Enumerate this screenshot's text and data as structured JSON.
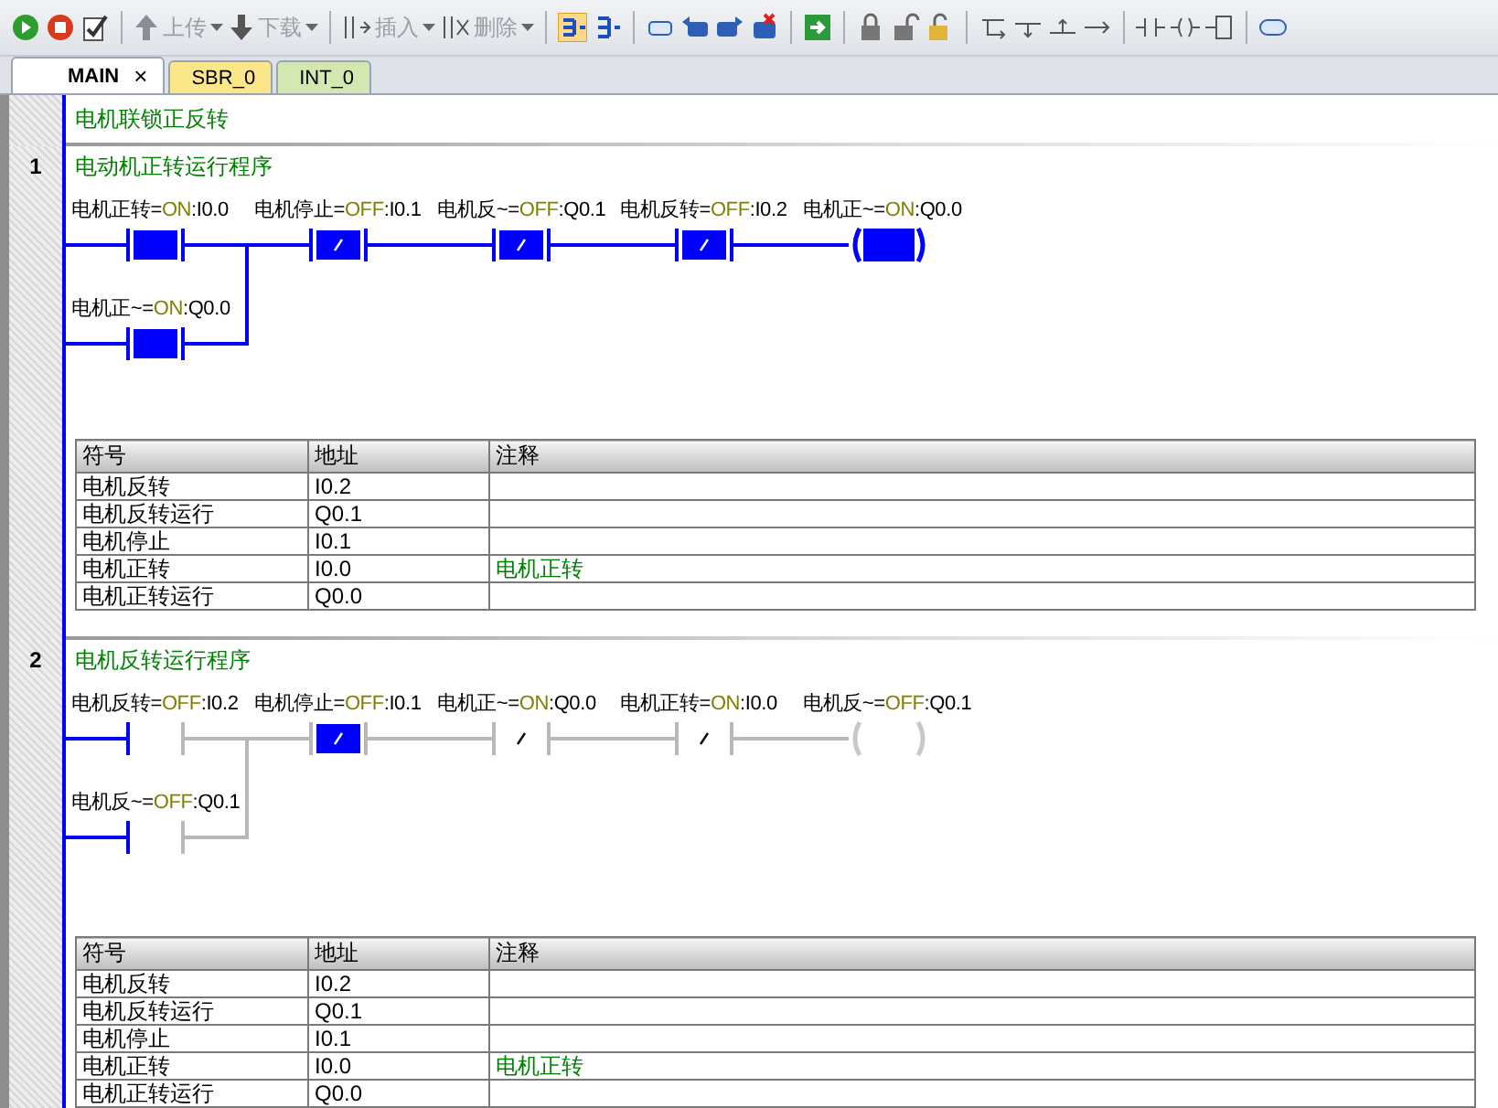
{
  "toolbar": {
    "buttons": [
      {
        "label": "上传",
        "disabled": true
      },
      {
        "label": "下载",
        "disabled": true
      },
      {
        "label": "插入",
        "disabled": true
      },
      {
        "label": "删除",
        "disabled": true
      }
    ]
  },
  "tabs": [
    {
      "label": "MAIN",
      "selected": true,
      "color": "#ffffff",
      "close": "×"
    },
    {
      "label": "SBR_0",
      "selected": false,
      "color": "#fbe68a"
    },
    {
      "label": "INT_0",
      "selected": false,
      "color": "#d3e8b0"
    }
  ],
  "program_title": "电机联锁正反转",
  "networks": [
    {
      "number": "1",
      "title": "电动机正转运行程序",
      "rung": [
        {
          "kind": "contact-no",
          "name": "电机正转=",
          "state": "ON",
          "address": ":I0.0",
          "powered": true,
          "active": true
        },
        {
          "kind": "contact-nc",
          "name": "电机停止=",
          "state": "OFF",
          "address": ":I0.1",
          "powered": true,
          "active": true
        },
        {
          "kind": "contact-nc",
          "name": "电机反~=",
          "state": "OFF",
          "address": ":Q0.1",
          "powered": true,
          "active": true
        },
        {
          "kind": "contact-nc",
          "name": "电机反转=",
          "state": "OFF",
          "address": ":I0.2",
          "powered": true,
          "active": true
        },
        {
          "kind": "coil",
          "name": "电机正~=",
          "state": "ON",
          "address": ":Q0.0",
          "powered": true,
          "active": true
        }
      ],
      "branch": {
        "kind": "contact-no",
        "name": "电机正~=",
        "state": "ON",
        "address": ":Q0.0",
        "powered": true,
        "active": true
      },
      "table": {
        "columns": [
          "符号",
          "地址",
          "注释"
        ],
        "rows": [
          [
            "电机反转",
            "I0.2",
            ""
          ],
          [
            "电机反转运行",
            "Q0.1",
            ""
          ],
          [
            "电机停止",
            "I0.1",
            ""
          ],
          [
            "电机正转",
            "I0.0",
            "电机正转"
          ],
          [
            "电机正转运行",
            "Q0.0",
            ""
          ]
        ]
      }
    },
    {
      "number": "2",
      "title": "电机反转运行程序",
      "rung": [
        {
          "kind": "contact-no",
          "name": "电机反转=",
          "state": "OFF",
          "address": ":I0.2",
          "powered": true,
          "active": false
        },
        {
          "kind": "contact-nc",
          "name": "电机停止=",
          "state": "OFF",
          "address": ":I0.1",
          "powered": false,
          "active": true
        },
        {
          "kind": "contact-nc",
          "name": "电机正~=",
          "state": "ON",
          "address": ":Q0.0",
          "powered": false,
          "active": false
        },
        {
          "kind": "contact-nc",
          "name": "电机正转=",
          "state": "ON",
          "address": ":I0.0",
          "powered": false,
          "active": false
        },
        {
          "kind": "coil",
          "name": "电机反~=",
          "state": "OFF",
          "address": ":Q0.1",
          "powered": false,
          "active": false
        }
      ],
      "branch": {
        "kind": "contact-no",
        "name": "电机反~=",
        "state": "OFF",
        "address": ":Q0.1",
        "powered": true,
        "active": false
      },
      "table": {
        "columns": [
          "符号",
          "地址",
          "注释"
        ],
        "rows": [
          [
            "电机反转",
            "I0.2",
            ""
          ],
          [
            "电机反转运行",
            "Q0.1",
            ""
          ],
          [
            "电机停止",
            "I0.1",
            ""
          ],
          [
            "电机正转",
            "I0.0",
            "电机正转"
          ],
          [
            "电机正转运行",
            "Q0.0",
            ""
          ]
        ]
      }
    }
  ]
}
